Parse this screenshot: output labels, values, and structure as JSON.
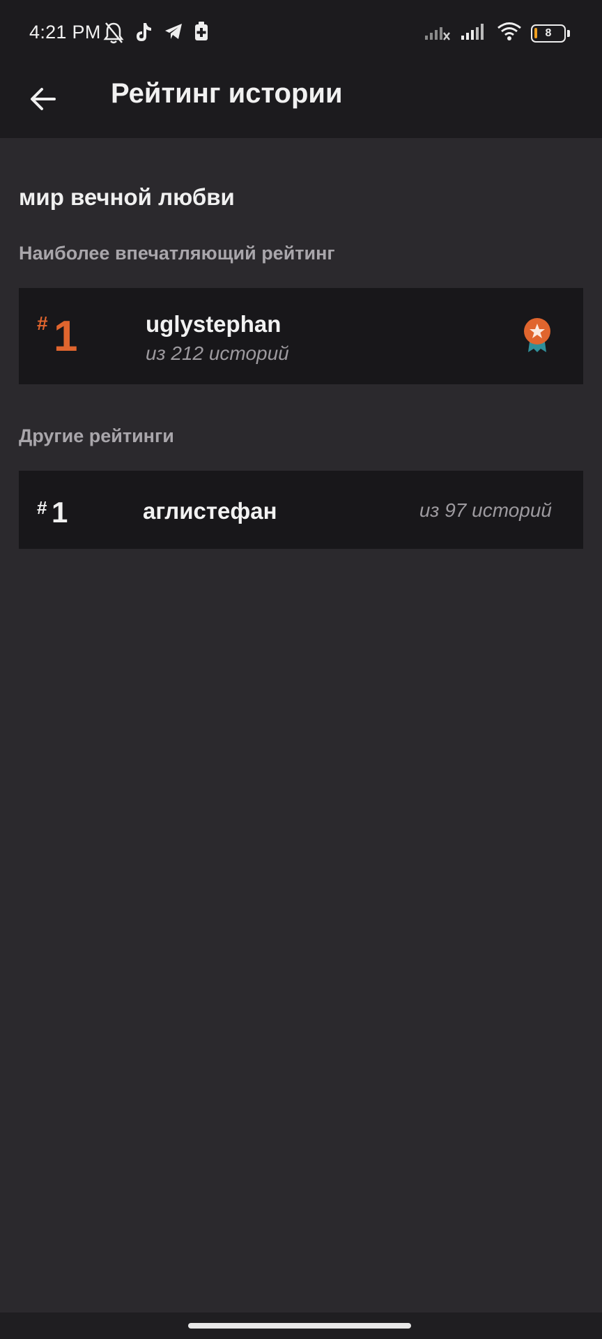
{
  "status_bar": {
    "time": "4:21 PM",
    "battery_level": "8",
    "left_icons": [
      "bell-off-icon",
      "tiktok-icon",
      "telegram-icon",
      "battery-saver-icon"
    ],
    "right_icons": [
      "signal-no-service-icon",
      "signal-icon",
      "wifi-icon",
      "battery-icon"
    ]
  },
  "app_bar": {
    "title": "Рейтинг истории",
    "back_icon": "arrow-left-icon"
  },
  "story": {
    "title": "мир вечной любви"
  },
  "sections": {
    "top_label": "Наиболее впечатляющий рейтинг",
    "other_label": "Другие рейтинги"
  },
  "top_rank": {
    "hash": "#",
    "rank": "1",
    "username": "uglystephan",
    "count": "из 212 историй",
    "badge_icon": "award-ribbon-icon",
    "accent_color": "#e0652e"
  },
  "other_ranks": [
    {
      "hash": "#",
      "rank": "1",
      "username": "аглистефан",
      "count": "из 97 историй"
    }
  ],
  "colors": {
    "background": "#2b292d",
    "bar": "#1c1b1e",
    "card": "#18171a",
    "accent": "#e0652e",
    "badge_ribbon": "#2f8f9a"
  }
}
